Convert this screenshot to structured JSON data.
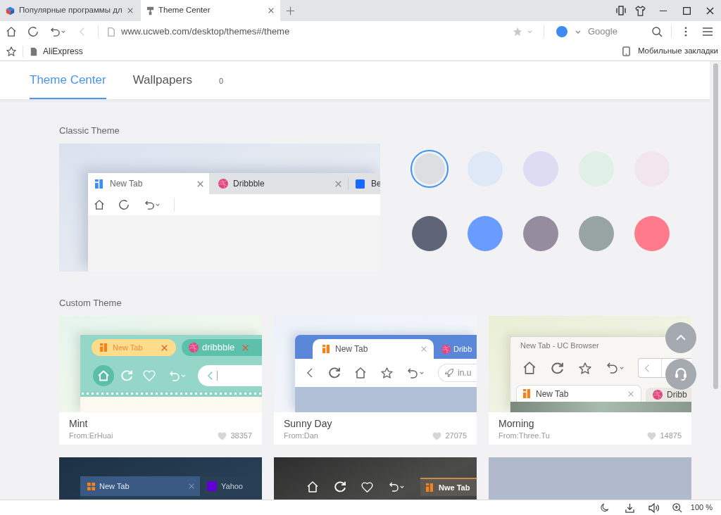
{
  "browser": {
    "tabs": [
      {
        "title": "Популярные программы дл",
        "selected": false
      },
      {
        "title": "Theme Center",
        "selected": true
      }
    ],
    "toolbar": {
      "back_button": {
        "disabled": true
      },
      "url": "www.ucweb.com/desktop/themes#/theme",
      "search_placeholder": "Google"
    },
    "bookmarks": [
      {
        "label": "AliExpress"
      }
    ],
    "mobile_bookmarks": "Мобильные закладки"
  },
  "page": {
    "nav_tabs": [
      {
        "label": "Theme Center",
        "selected": true
      },
      {
        "label": "Wallpapers",
        "selected": false
      }
    ],
    "wallpaper_count": "0",
    "classic_theme": {
      "title": "Classic Theme",
      "preview_tabs": [
        "New Tab",
        "Dribbble",
        "Be"
      ],
      "swatches": [
        {
          "color": "#dddee1",
          "selected": true
        },
        {
          "color": "#dfe8f6",
          "selected": false
        },
        {
          "color": "#dcdcf2",
          "selected": false
        },
        {
          "color": "#e1f0e6",
          "selected": false
        },
        {
          "color": "#f3e5ec",
          "selected": false
        },
        {
          "color": "#5e6577",
          "selected": false
        },
        {
          "color": "#6a9bff",
          "selected": false
        },
        {
          "color": "#958d9f",
          "selected": false
        },
        {
          "color": "#98a5a2",
          "selected": false
        },
        {
          "color": "#ff7a8b",
          "selected": false
        }
      ]
    },
    "custom_theme": {
      "title": "Custom Theme",
      "cards": [
        {
          "kind": "mint",
          "name": "Mint",
          "author": "From:ErHuai",
          "likes": "38357",
          "tabs": [
            "New Tab",
            "dribbble"
          ]
        },
        {
          "kind": "sunny",
          "name": "Sunny Day",
          "author": "From:Dan",
          "likes": "27075",
          "tabs": [
            "New Tab",
            "Dribb"
          ],
          "address": "in.u"
        },
        {
          "kind": "morning",
          "name": "Morning",
          "author": "From:Three.Tu",
          "likes": "14875",
          "window_title": "New Tab - UC Browser",
          "tabs": [
            "New Tab",
            "Dribb"
          ]
        },
        {
          "kind": "dark",
          "tabs": [
            "New Tab",
            "Yahoo"
          ]
        },
        {
          "kind": "photo",
          "tabs": [
            "Nwe Tab"
          ]
        },
        {
          "kind": "plain"
        }
      ]
    }
  },
  "status_bar": {
    "zoom": "100 %"
  }
}
